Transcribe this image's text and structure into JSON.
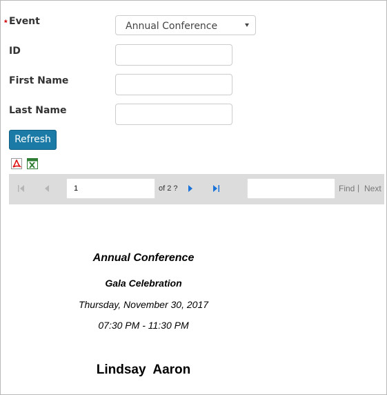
{
  "form": {
    "required_marker": "*",
    "event_label": "Event",
    "event_value": "Annual Conference",
    "id_label": "ID",
    "first_name_label": "First Name",
    "last_name_label": "Last Name",
    "refresh_label": "Refresh"
  },
  "export": {
    "pdf_icon": "pdf-export-icon",
    "excel_icon": "excel-export-icon"
  },
  "viewer": {
    "current_page": "1",
    "of_pages": "of 2 ?",
    "find_label": "Find",
    "separator": "|",
    "next_label": "Next"
  },
  "report": {
    "event_title": "Annual Conference",
    "session_title": "Gala Celebration",
    "date": "Thursday, November 30, 2017",
    "time": "07:30 PM - 11:30 PM",
    "attendee_name": "Lindsay  Aaron"
  },
  "colors": {
    "accent": "#1b7ba6",
    "required": "#cc0000",
    "toolbar": "#dcdcdc"
  }
}
